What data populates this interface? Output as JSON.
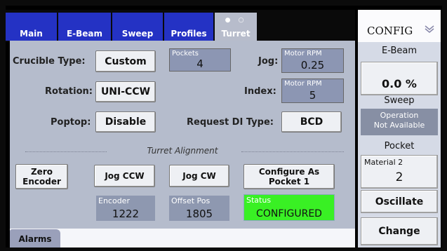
{
  "tabs": [
    {
      "label": "Main"
    },
    {
      "label": "E-Beam"
    },
    {
      "label": "Sweep"
    },
    {
      "label": "Profiles"
    },
    {
      "label": "Turret",
      "active": true
    }
  ],
  "page_indicator": "● ○",
  "fields": {
    "crucible_type_label": "Crucible Type:",
    "crucible_type_value": "Custom",
    "pockets_caption": "Pockets",
    "pockets_value": "4",
    "jog_label": "Jog:",
    "jog_caption": "Motor RPM",
    "jog_value": "0.25",
    "rotation_label": "Rotation:",
    "rotation_value": "UNI-CCW",
    "index_label": "Index:",
    "index_caption": "Motor RPM",
    "index_value": "5",
    "poptop_label": "Poptop:",
    "poptop_value": "Disable",
    "request_di_label": "Request DI Type:",
    "request_di_value": "BCD"
  },
  "alignment": {
    "title": "Turret Alignment",
    "zero_encoder": "Zero\nEncoder",
    "jog_ccw": "Jog CCW",
    "jog_cw": "Jog CW",
    "configure_as": "Configure As\nPocket 1",
    "encoder_caption": "Encoder",
    "encoder_value": "1222",
    "offset_caption": "Offset Pos",
    "offset_value": "1805",
    "status_caption": "Status",
    "status_value": "CONFIGURED"
  },
  "alarms_label": "Alarms",
  "right": {
    "config_title": "CONFIG",
    "ebeam_title": "E-Beam",
    "ebeam_value": "0.0 %",
    "sweep_title": "Sweep",
    "sweep_status": "Operation\nNot Available",
    "pocket_title": "Pocket",
    "material_caption": "Material 2",
    "material_value": "2",
    "oscillate_label": "Oscillate",
    "change_label": "Change"
  },
  "colors": {
    "tab_blue": "#2432c4",
    "panel": "#b5bccc",
    "field": "#8c96b3",
    "status_green": "#39f024"
  },
  "icons": {
    "config_chevron": "chevron-down-icon"
  }
}
